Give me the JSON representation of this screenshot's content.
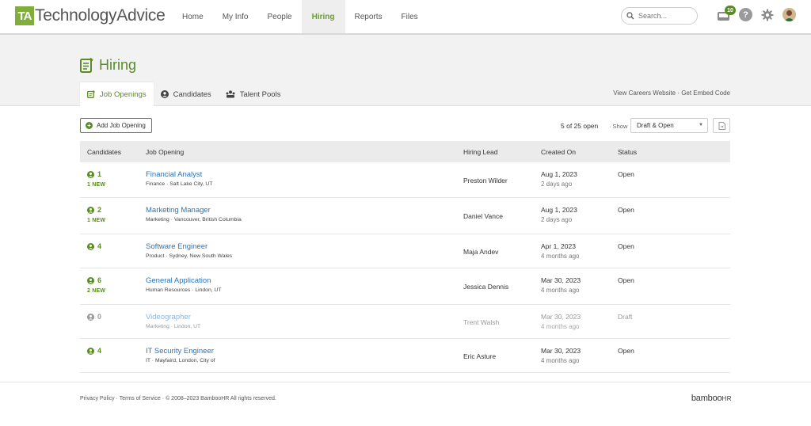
{
  "brand": {
    "mark": "TA",
    "name": "TechnologyAdvice",
    "accent": "#5a8c22"
  },
  "nav": {
    "items": [
      "Home",
      "My Info",
      "People",
      "Hiring",
      "Reports",
      "Files"
    ],
    "active": "Hiring"
  },
  "search": {
    "placeholder": "Search..."
  },
  "toolbar": {
    "inbox_count": "10",
    "help_glyph": "?"
  },
  "page": {
    "title": "Hiring"
  },
  "tabs": {
    "items": [
      "Job Openings",
      "Candidates",
      "Talent Pools"
    ],
    "active": "Job Openings",
    "links": [
      "View Careers Website",
      "Get Embed Code"
    ],
    "link_sep": "·"
  },
  "actions": {
    "add_label": "Add Job Opening",
    "count_text": "5 of 25 open",
    "sep": "·",
    "show_label": "Show",
    "filter_value": "Draft & Open"
  },
  "table": {
    "headers": [
      "Candidates",
      "Job Opening",
      "Hiring Lead",
      "Created On",
      "Status"
    ],
    "rows": [
      {
        "candidates": "1",
        "new": "1 NEW",
        "title": "Financial Analyst",
        "sub": "Finance · Salt Lake City, UT",
        "lead": "Preston Wilder",
        "created": "Aug 1, 2023",
        "relative": "2 days ago",
        "status": "Open"
      },
      {
        "candidates": "2",
        "new": "1 NEW",
        "title": "Marketing Manager",
        "sub": "Marketing · Vancouver, British Columbia",
        "lead": "Daniel Vance",
        "created": "Aug 1, 2023",
        "relative": "2 days ago",
        "status": "Open"
      },
      {
        "candidates": "4",
        "new": "",
        "title": "Software Engineer",
        "sub": "Product · Sydney, New South Wales",
        "lead": "Maja Andev",
        "created": "Apr 1, 2023",
        "relative": "4 months ago",
        "status": "Open"
      },
      {
        "candidates": "6",
        "new": "2 NEW",
        "title": "General Application",
        "sub": "Human Resources · Lindon, UT",
        "lead": "Jessica Dennis",
        "created": "Mar 30, 2023",
        "relative": "4 months ago",
        "status": "Open"
      },
      {
        "candidates": "0",
        "new": "",
        "title": "Videographer",
        "sub": "Marketing · Lindon, UT",
        "lead": "Trent Walsh",
        "created": "Mar 30, 2023",
        "relative": "4 months ago",
        "status": "Draft"
      },
      {
        "candidates": "4",
        "new": "",
        "title": "IT Security Engineer",
        "sub": "IT · Mayfaird, London, City of",
        "lead": "Eric Asture",
        "created": "Mar 30, 2023",
        "relative": "4 months ago",
        "status": "Open"
      }
    ]
  },
  "footer": {
    "links": [
      "Privacy Policy",
      "Terms of Service"
    ],
    "sep": "·",
    "copyright": "© 2008–2023 BambooHR All rights reserved.",
    "logo_main": "bamboo",
    "logo_suffix": "HR"
  }
}
